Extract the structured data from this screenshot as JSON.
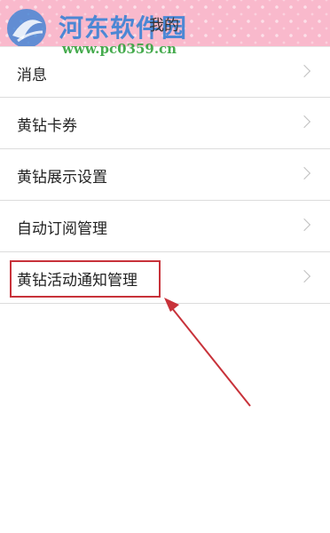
{
  "header": {
    "watermark_title": "河东软件园",
    "watermark_url": "www.pc0359.cn",
    "title": "我的"
  },
  "menu": {
    "items": [
      {
        "label": "消息",
        "icon": "chevron-right-icon"
      },
      {
        "label": "黄钻卡券",
        "icon": "chevron-right-icon"
      },
      {
        "label": "黄钻展示设置",
        "icon": "chevron-right-icon"
      },
      {
        "label": "自动订阅管理",
        "icon": "chevron-right-icon"
      },
      {
        "label": "黄钻活动通知管理",
        "icon": "chevron-right-icon"
      }
    ]
  },
  "annotation": {
    "color": "#c8323a"
  },
  "colors": {
    "header_bg": "#f9b9cc",
    "watermark_blue": "#2f7fd6",
    "watermark_green": "#32a23b"
  }
}
